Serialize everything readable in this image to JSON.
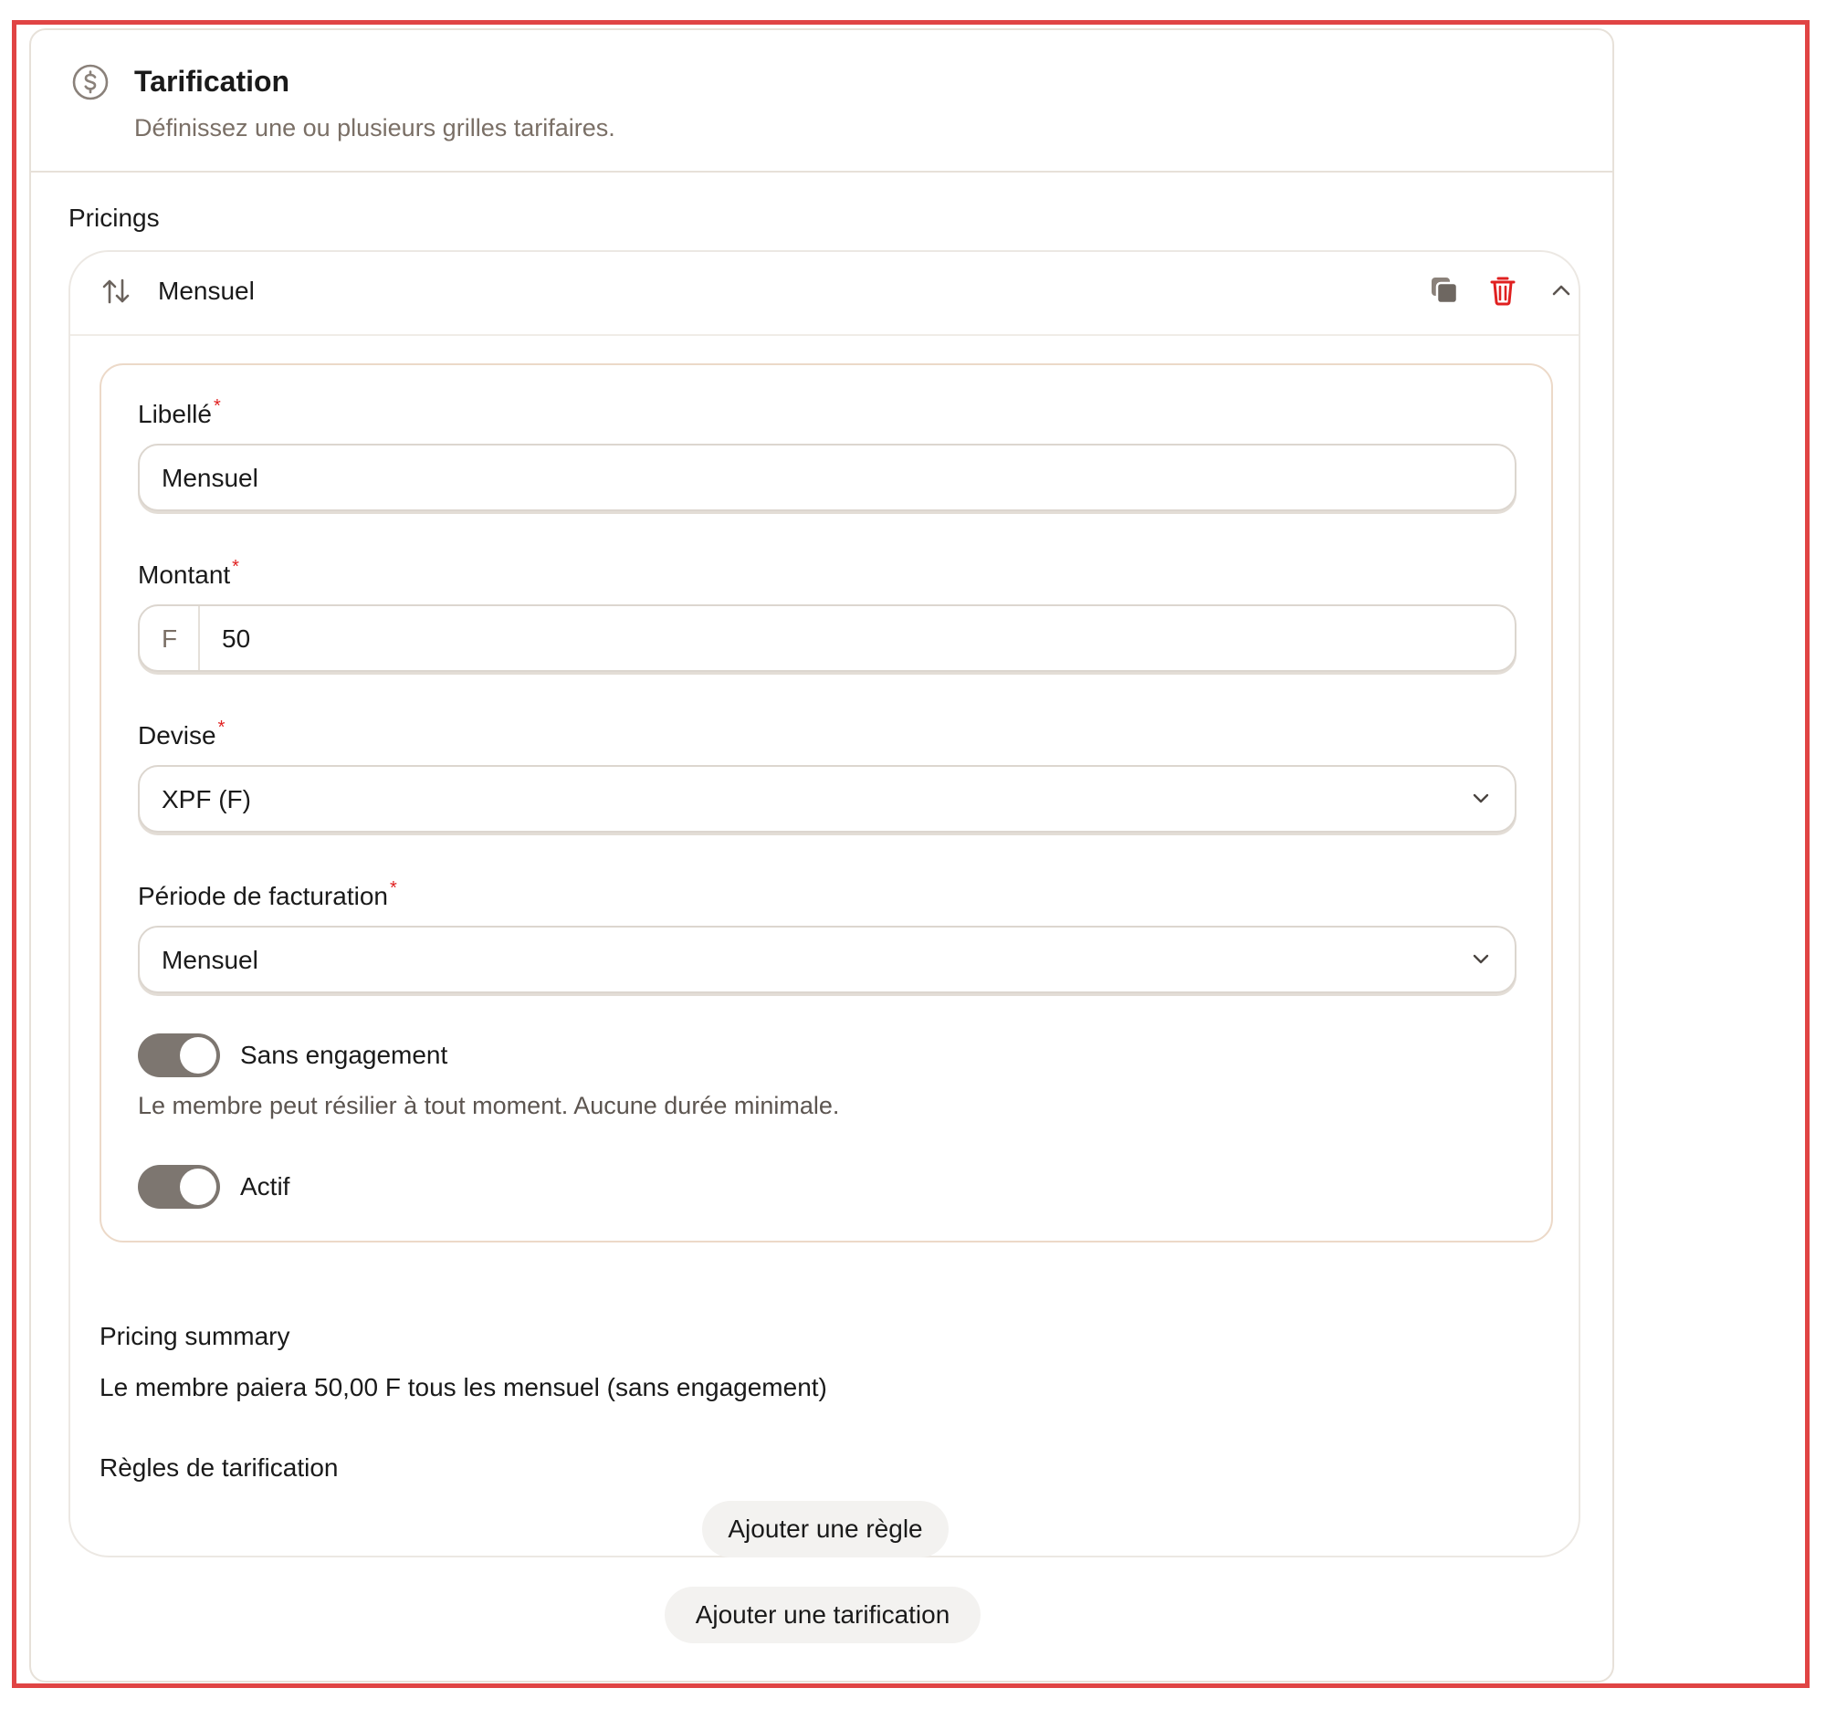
{
  "header": {
    "title": "Tarification",
    "subtitle": "Définissez une ou plusieurs grilles tarifaires.",
    "icon": "dollar-circle-icon"
  },
  "section_label": "Pricings",
  "pricing_item": {
    "title": "Mensuel",
    "icons": {
      "sort": "sort-arrows-icon",
      "copy": "copy-icon",
      "delete": "trash-icon",
      "collapse": "chevron-up-icon"
    },
    "fields": {
      "label": {
        "label": "Libellé",
        "required_mark": "*",
        "value": "Mensuel"
      },
      "amount": {
        "label": "Montant",
        "required_mark": "*",
        "prefix": "F",
        "value": "50"
      },
      "currency": {
        "label": "Devise",
        "required_mark": "*",
        "value": "XPF (F)"
      },
      "billing_period": {
        "label": "Période de facturation",
        "required_mark": "*",
        "value": "Mensuel"
      }
    },
    "toggles": {
      "no_commitment": {
        "label": "Sans engagement",
        "on": true,
        "helper": "Le membre peut résilier à tout moment. Aucune durée minimale."
      },
      "active": {
        "label": "Actif",
        "on": true
      }
    },
    "summary": {
      "label": "Pricing summary",
      "text": "Le membre paiera 50,00 F tous les mensuel (sans engagement)"
    },
    "rules": {
      "label": "Règles de tarification",
      "add_button": "Ajouter une règle"
    }
  },
  "add_pricing_button": "Ajouter une tarification",
  "colors": {
    "danger": "#e02020",
    "toggle_on": "#7d7670",
    "muted_text": "#7a6f66",
    "frame": "#e04444"
  }
}
